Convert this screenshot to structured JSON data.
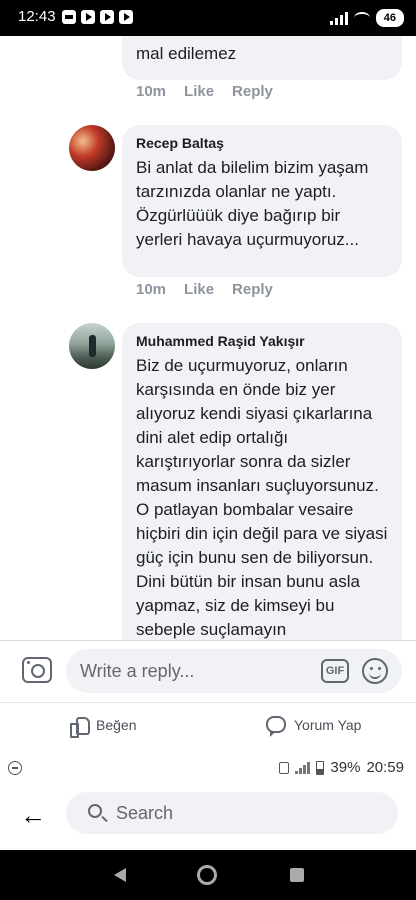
{
  "status_bar": {
    "time": "12:43",
    "battery": "46"
  },
  "comments": [
    {
      "text": "mal edilemez",
      "time": "10m",
      "like": "Like",
      "reply": "Reply"
    },
    {
      "author": "Recep Baltaş",
      "text": "Bi anlat da bilelim bizim yaşam tarzınızda olanlar ne yaptı. Özgürlüüük diye bağırıp bir yerleri havaya uçurmuyoruz...",
      "time": "10m",
      "like": "Like",
      "reply": "Reply"
    },
    {
      "author": "Muhammed Raşid Yakışır",
      "text": "Biz de uçurmuyoruz, onların karşısında en önde biz yer alıyoruz kendi siyasi çıkarlarına dini alet edip ortalığı karıştırıyorlar sonra da sizler masum insanları suçluyorsunuz. O patlayan bombalar vesaire hiçbiri din için değil para ve siyasi güç için bunu sen de biliyorsun. Dini bütün bir insan bunu asla yapmaz, siz de kimseyi bu sebeple suçlamayın"
    }
  ],
  "composer": {
    "placeholder": "Write a reply...",
    "gif": "GIF"
  },
  "likebar": {
    "like": "Beğen",
    "comment": "Yorum Yap"
  },
  "status_bar_2": {
    "battery": "39%",
    "time": "20:59"
  },
  "search": {
    "placeholder": "Search"
  },
  "colors": {
    "bubble": "#f0f2f5",
    "meta": "#8d949e"
  }
}
